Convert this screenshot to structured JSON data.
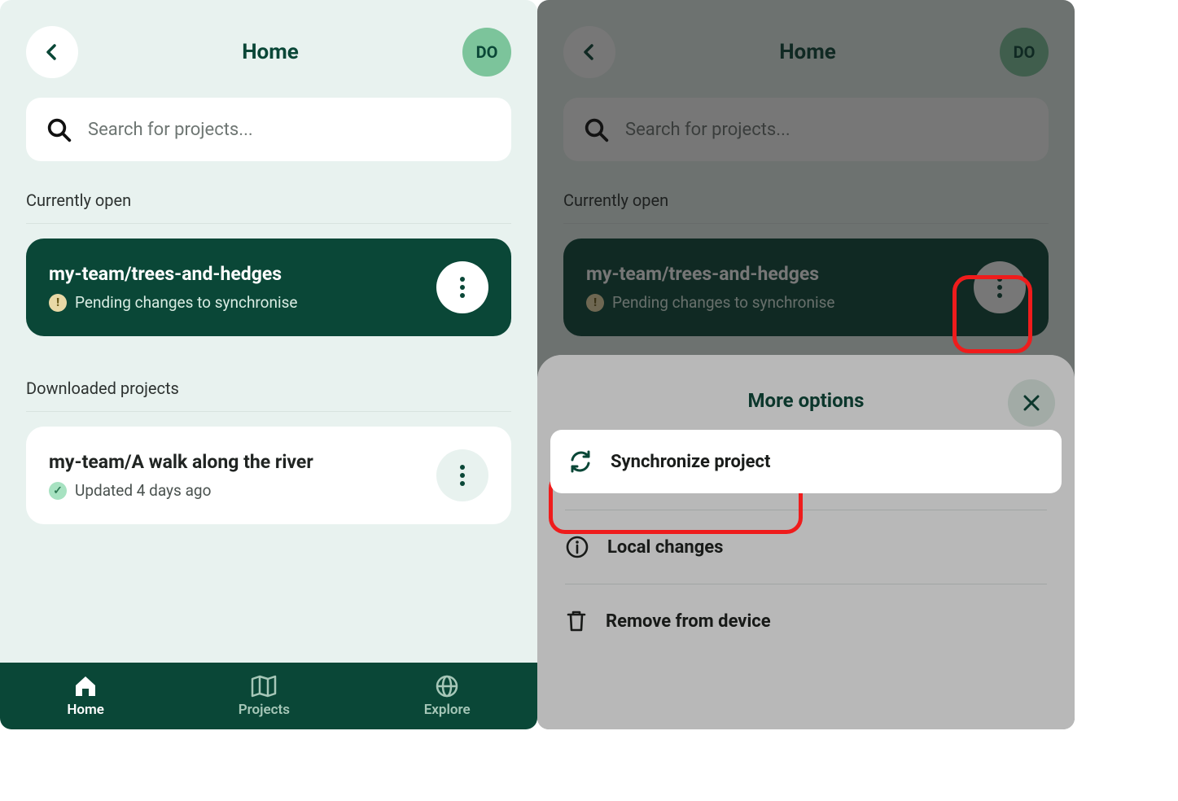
{
  "header": {
    "title": "Home",
    "avatar_initials": "DO"
  },
  "search": {
    "placeholder": "Search for projects..."
  },
  "sections": {
    "currently_open_label": "Currently open",
    "downloaded_label": "Downloaded projects"
  },
  "currently_open": {
    "title": "my-team/trees-and-hedges",
    "status": "Pending changes to synchronise"
  },
  "downloaded": {
    "title": "my-team/A walk along the river",
    "status": "Updated 4 days ago"
  },
  "nav": {
    "home": "Home",
    "projects": "Projects",
    "explore": "Explore"
  },
  "sheet": {
    "title": "More options",
    "items": {
      "sync": "Synchronize project",
      "local": "Local changes",
      "remove": "Remove from device"
    }
  }
}
